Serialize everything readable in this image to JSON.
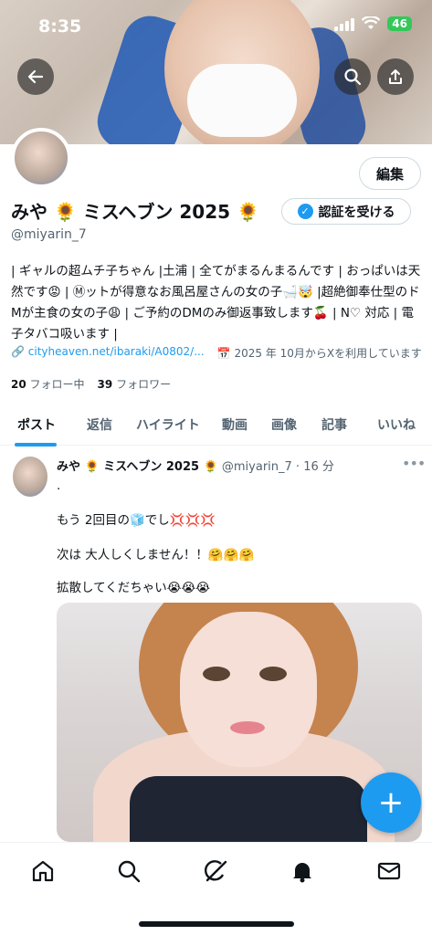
{
  "status": {
    "time": "8:35",
    "battery": "46"
  },
  "profile": {
    "display_name": "みや 🌻 ミスヘブン 2025 🌻",
    "handle": "@miyarin_7",
    "edit_label": "編集",
    "verify_label": "認証を受ける",
    "bio": "| ギャルの超ムチ子ちゃん |土浦 | 全てがまるんまるんです | おっぱいは天然です😡 | Ⓜットが得意なお風呂屋さんの女の子🛁🤯 |超絶御奉仕型のドMが主食の女の子😩 | ご予約のDMのみ御返事致します🍒 | N♡ 対応 | 電子タバコ吸います |",
    "link": "cityheaven.net/ibaraki/A0802/...",
    "joined": "2025 年 10月からXを利用しています",
    "following_count": "20",
    "following_label": "フォロー中",
    "followers_count": "39",
    "followers_label": "フォロワー"
  },
  "tabs": [
    "ポスト",
    "返信",
    "ハイライト",
    "動画",
    "画像",
    "記事",
    "いいね"
  ],
  "post": {
    "name": "みや 🌻 ミスヘブン 2025 🌻",
    "handle_time": "@miyarin_7 · 16 分",
    "line0": ".",
    "line1": "もう 2回目の🧊でし💢💢💢",
    "line2": "次は 大人しくしません！！🤗🤗🤗",
    "line3": "拡散してくだちゃい😭😭😭"
  },
  "fab_label": "+",
  "icons": {
    "back": "back-arrow-icon",
    "search": "search-icon",
    "share": "share-icon",
    "home": "home-icon",
    "explore": "search-icon",
    "grok": "grok-icon",
    "notifications": "bell-icon",
    "messages": "mail-icon"
  },
  "colors": {
    "accent": "#1d9bf0",
    "text": "#0f1419",
    "secondary": "#536471"
  }
}
